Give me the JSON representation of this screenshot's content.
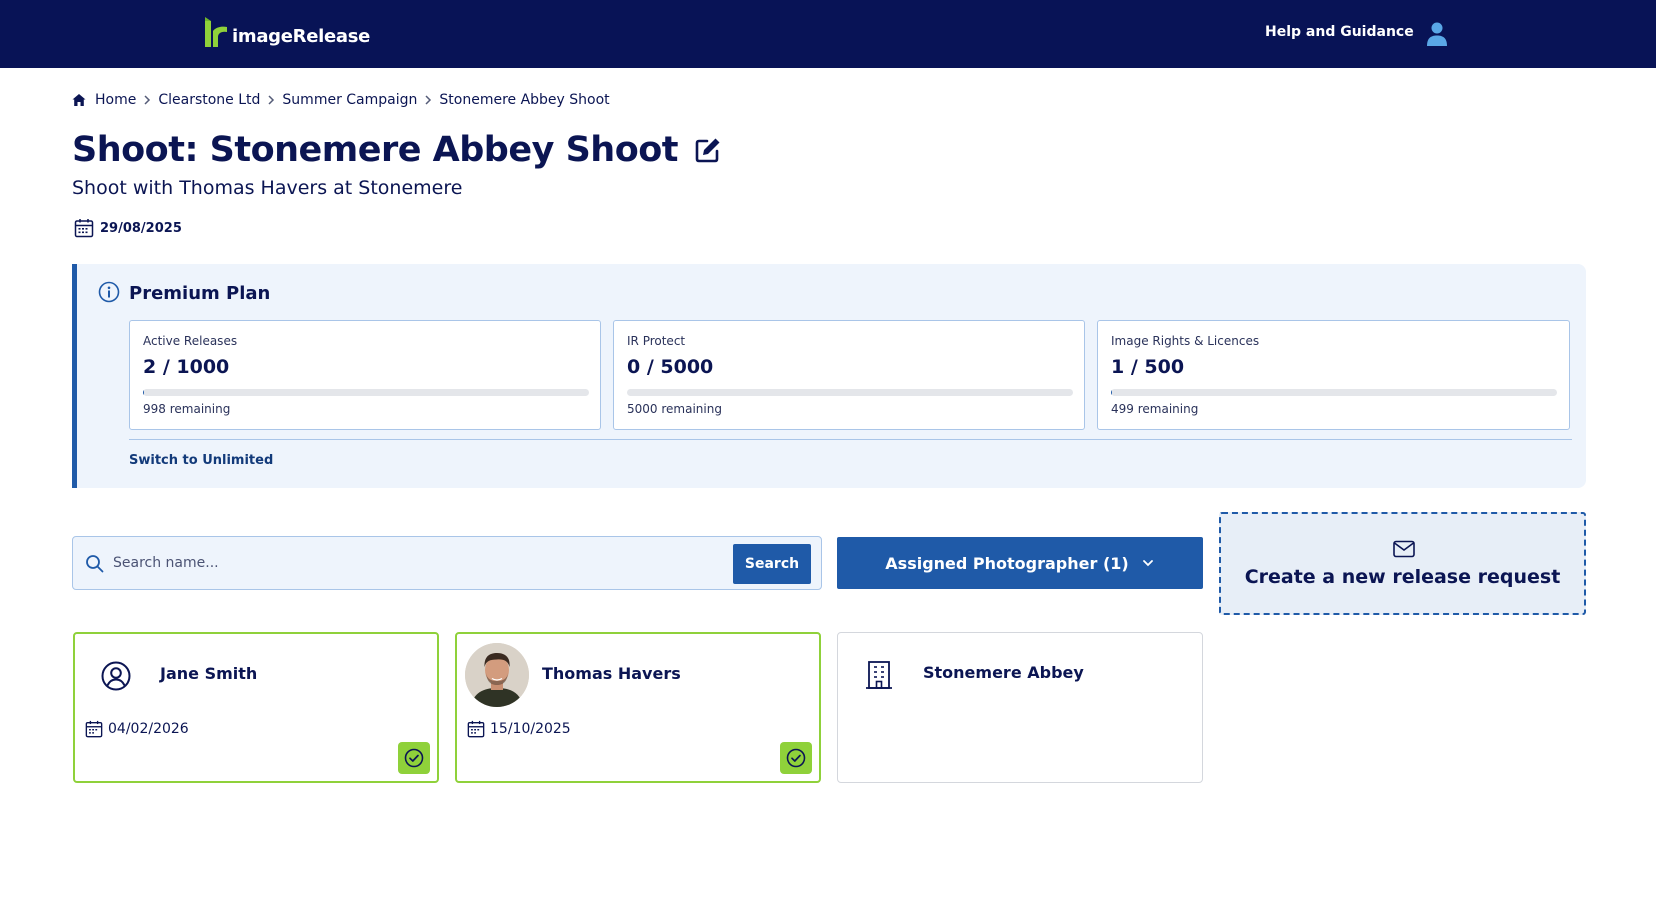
{
  "header": {
    "logo_text": "imageRelease",
    "help_label": "Help and Guidance"
  },
  "breadcrumb": [
    "Home",
    "Clearstone Ltd",
    "Summer Campaign",
    "Stonemere Abbey Shoot"
  ],
  "page": {
    "title": "Shoot: Stonemere Abbey Shoot",
    "subtitle": "Shoot with Thomas Havers at Stonemere",
    "date": "29/08/2025"
  },
  "plan": {
    "title": "Premium Plan",
    "usage": [
      {
        "label": "Active Releases",
        "value": "2 / 1000",
        "used": 2,
        "limit": 1000,
        "remaining": "998 remaining"
      },
      {
        "label": "IR Protect",
        "value": "0 / 5000",
        "used": 0,
        "limit": 5000,
        "remaining": "5000 remaining"
      },
      {
        "label": "Image Rights & Licences",
        "value": "1 / 500",
        "used": 1,
        "limit": 500,
        "remaining": "499 remaining"
      }
    ],
    "switch_label": "Switch to Unlimited"
  },
  "search": {
    "placeholder": "Search name...",
    "button_label": "Search"
  },
  "assigned": {
    "label": "Assigned Photographer (1)"
  },
  "create": {
    "label": "Create a new release request"
  },
  "cards": [
    {
      "name": "Jane Smith",
      "date": "04/02/2026",
      "status": "complete"
    },
    {
      "name": "Thomas Havers",
      "date": "15/10/2025",
      "status": "complete"
    },
    {
      "name": "Stonemere Abbey"
    }
  ],
  "colors": {
    "navy": "#081356",
    "primary_blue": "#1f5aa8",
    "success_green": "#8fd13a",
    "panel_bg": "#eef4fc"
  },
  "icons": [
    "home-icon",
    "chevron-right-icon",
    "edit-icon",
    "calendar-icon",
    "info-icon",
    "search-icon",
    "chevron-down-icon",
    "mail-icon",
    "user-circle-icon",
    "building-icon",
    "check-circle-icon",
    "user-icon"
  ]
}
